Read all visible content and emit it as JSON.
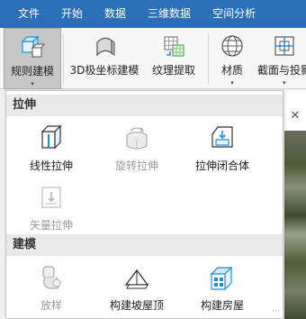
{
  "menubar": {
    "items": [
      "文件",
      "开始",
      "数据",
      "三维数据",
      "空间分析"
    ]
  },
  "ribbon": {
    "buttons": [
      {
        "label": "规则建模",
        "active": true,
        "has_arrow": true
      },
      {
        "label": "3D极坐标建模",
        "active": false,
        "has_arrow": false
      },
      {
        "label": "纹理提取",
        "active": false,
        "has_arrow": false
      },
      {
        "label": "材质",
        "active": false,
        "has_arrow": true
      },
      {
        "label": "截面与投影",
        "active": false,
        "has_arrow": true
      }
    ],
    "dropdown_arrow_glyph": "▾"
  },
  "dropdown": {
    "sections": [
      {
        "title": "拉伸",
        "items": [
          {
            "label": "线性拉伸",
            "enabled": true,
            "icon": "linear-extrude-icon"
          },
          {
            "label": "旋转拉伸",
            "enabled": false,
            "icon": "rotate-extrude-icon"
          },
          {
            "label": "拉伸闭合体",
            "enabled": true,
            "icon": "extrude-closed-icon"
          },
          {
            "label": "矢量拉伸",
            "enabled": false,
            "icon": "vector-extrude-icon"
          }
        ]
      },
      {
        "title": "建模",
        "items": [
          {
            "label": "放样",
            "enabled": false,
            "icon": "loft-icon"
          },
          {
            "label": "构建坡屋顶",
            "enabled": true,
            "icon": "slope-roof-icon"
          },
          {
            "label": "构建房屋",
            "enabled": true,
            "icon": "build-house-icon"
          }
        ]
      }
    ],
    "resize_handle_glyph": "⋯"
  },
  "colors": {
    "menubar_bg": "#2a6fb8",
    "accent": "#1e8fd6",
    "disabled": "#9a9a9a"
  }
}
